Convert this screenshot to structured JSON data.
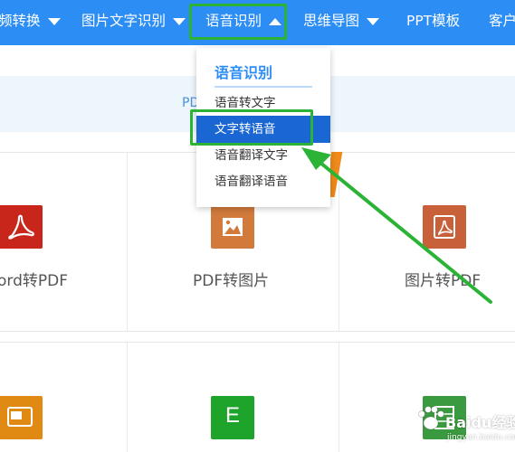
{
  "nav": {
    "items": [
      {
        "label": "频转换"
      },
      {
        "label": "图片文字识别"
      },
      {
        "label": "语音识别"
      },
      {
        "label": "思维导图"
      },
      {
        "label": "PPT模板"
      },
      {
        "label": "客户"
      }
    ]
  },
  "subbar": {
    "text": "PD"
  },
  "dropdown": {
    "title": "语音识别",
    "items": [
      {
        "label": "语音转文字"
      },
      {
        "label": "文字转语音"
      },
      {
        "label": "语音翻译文字"
      },
      {
        "label": "语音翻译语音"
      }
    ],
    "active_index": 1
  },
  "tiles": [
    {
      "label": "ord转PDF",
      "icon": "pdf-acrobat-icon",
      "color": "#c8251b"
    },
    {
      "label": "PDF转图片",
      "icon": "image-icon",
      "color": "#d17a3c"
    },
    {
      "label": "图片转PDF",
      "icon": "pdf-doc-icon",
      "color": "#c8603a"
    },
    {
      "label": "",
      "icon": "ppt-icon",
      "color": "#e08a14"
    },
    {
      "label": "",
      "icon": "excel-icon",
      "color": "#1ea32b"
    },
    {
      "label": "",
      "icon": "sheet-icon",
      "color": "#3a9a3f"
    }
  ],
  "excel_letter": "E",
  "watermark": {
    "text": "Baidu经验",
    "sub": "jingyan.baidu.com"
  },
  "colors": {
    "nav": "#2c8df4",
    "highlight": "#2bb336",
    "active_item": "#1a66d3"
  }
}
